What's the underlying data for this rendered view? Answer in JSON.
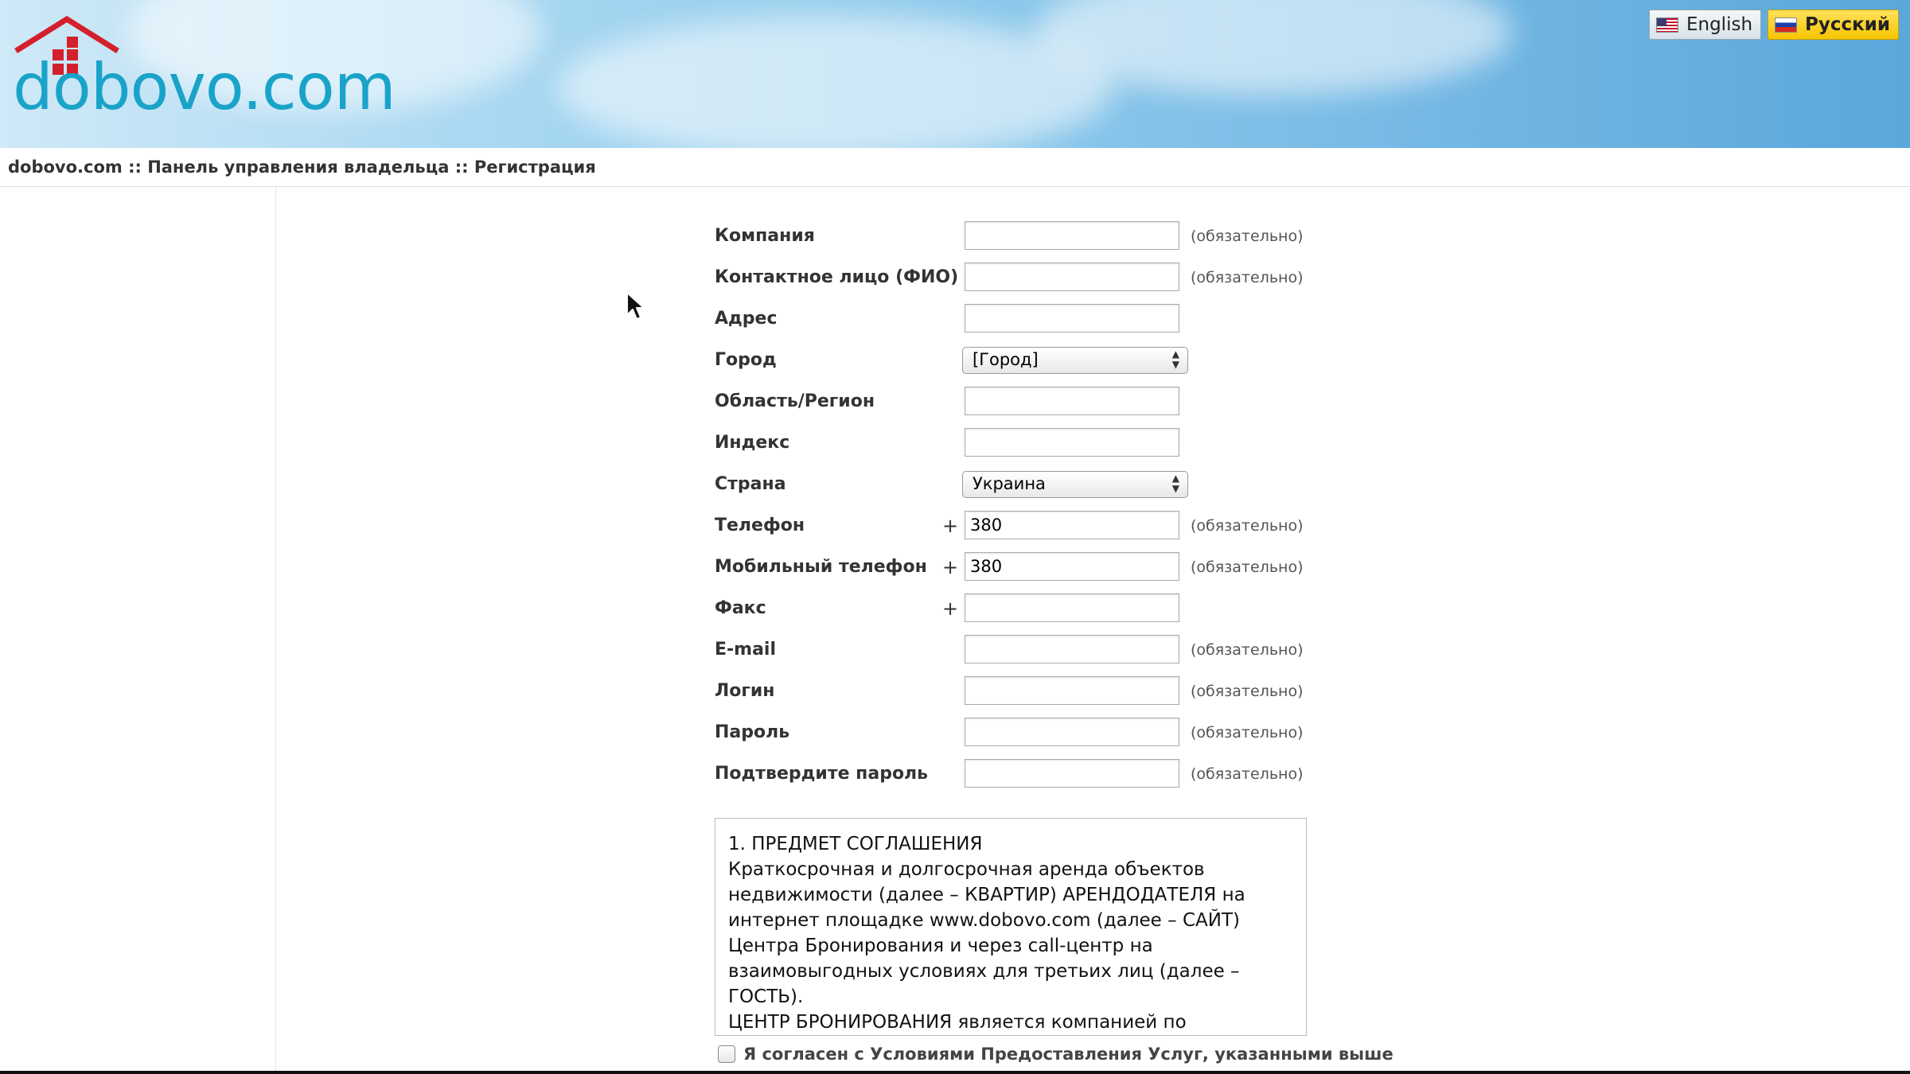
{
  "header": {
    "logo_text": "dobovo.com",
    "languages": [
      {
        "label": "English",
        "flag": "us-flag-icon",
        "active": false
      },
      {
        "label": "Русский",
        "flag": "ru-flag-icon",
        "active": true
      }
    ]
  },
  "breadcrumb": "dobovo.com :: Панель управления владельца :: Регистрация",
  "form": {
    "required_text": "(обязательно)",
    "fields": [
      {
        "label": "Компания",
        "type": "text",
        "value": "",
        "required": true
      },
      {
        "label": "Контактное лицо (ФИО)",
        "type": "text",
        "value": "",
        "required": true
      },
      {
        "label": "Адрес",
        "type": "text",
        "value": "",
        "required": false
      },
      {
        "label": "Город",
        "type": "select",
        "value": "[Город]",
        "required": false
      },
      {
        "label": "Область/Регион",
        "type": "text",
        "value": "",
        "required": false
      },
      {
        "label": "Индекс",
        "type": "text",
        "value": "",
        "required": false
      },
      {
        "label": "Страна",
        "type": "select",
        "value": "Украина",
        "required": false
      },
      {
        "label": "Телефон",
        "type": "text",
        "prefix": "+",
        "value": "380",
        "required": true
      },
      {
        "label": "Мобильный телефон",
        "type": "text",
        "prefix": "+",
        "value": "380",
        "required": true
      },
      {
        "label": "Факс",
        "type": "text",
        "prefix": "+",
        "value": "",
        "required": false
      },
      {
        "label": "E-mail",
        "type": "text",
        "value": "",
        "required": true
      },
      {
        "label": "Логин",
        "type": "text",
        "value": "",
        "required": true
      },
      {
        "label": "Пароль",
        "type": "password",
        "value": "",
        "required": true
      },
      {
        "label": "Подтвердите пароль",
        "type": "password",
        "value": "",
        "required": true
      }
    ]
  },
  "agreement": {
    "lines": [
      "1. ПРЕДМЕТ СОГЛАШЕНИЯ",
      "Краткосрочная и долгосрочная аренда объектов",
      "недвижимости (далее – КВАРТИР) АРЕНДОДАТЕЛЯ на",
      "интернет площадке www.dobovo.com (далее – САЙТ)",
      "Центра Бронирования и через call-центр на",
      "взаимовыгодных условиях для третьих лиц (далее –",
      "ГОСТЬ).",
      "ЦЕНТР БРОНИРОВАНИЯ является компанией по"
    ],
    "checkbox_label": "Я согласен с Условиями Предоставления Услуг, указанными выше",
    "checked": false
  },
  "colors": {
    "logo": "#1aa3c9",
    "logo_house": "#d4202c",
    "active_lang": "#f6c400"
  }
}
